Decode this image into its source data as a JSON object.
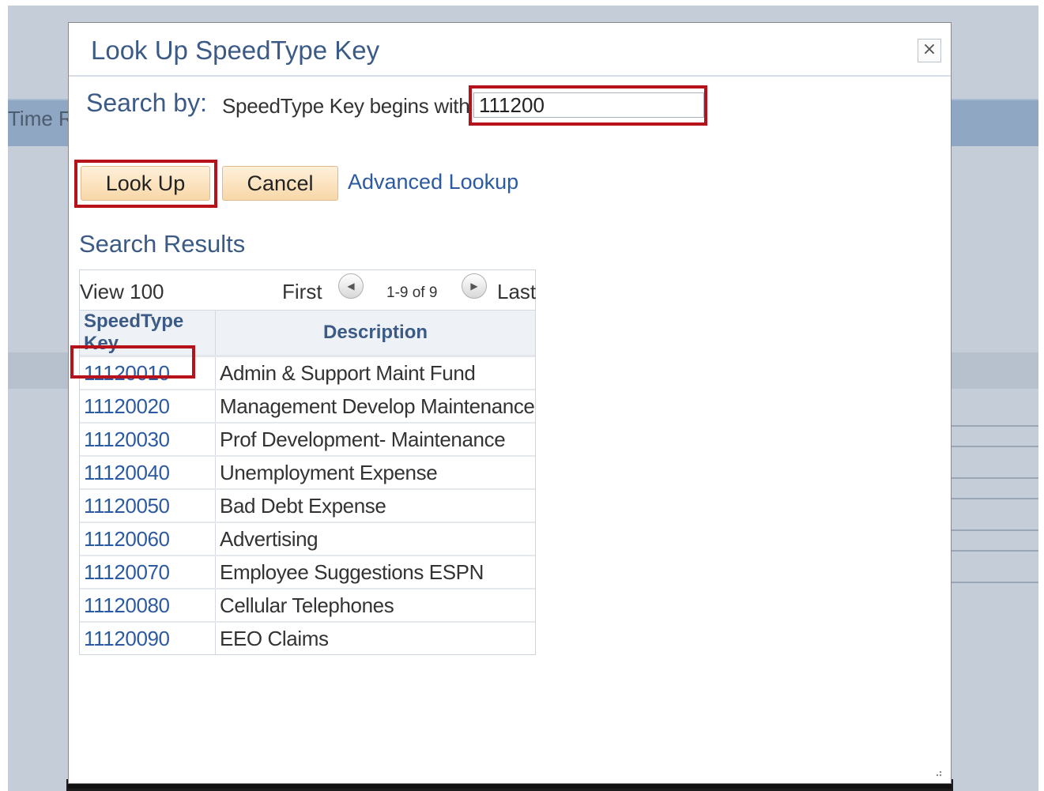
{
  "background": {
    "label_fragment": "Time R"
  },
  "dialog": {
    "title": "Look Up SpeedType Key",
    "close_glyph": "×",
    "search_by_label": "Search by:",
    "search_field_desc": "SpeedType Key begins with",
    "search_value": "111200",
    "lookup_button": "Look Up",
    "cancel_button": "Cancel",
    "advanced_link": "Advanced Lookup"
  },
  "results": {
    "heading": "Search Results",
    "nav": {
      "view": "View 100",
      "first": "First",
      "range": "1-9 of 9",
      "last": "Last"
    },
    "columns": [
      "SpeedType Key",
      "Description"
    ],
    "rows": [
      {
        "key": "11120010",
        "description": "Admin & Support Maint Fund"
      },
      {
        "key": "11120020",
        "description": "Management Develop Maintenance"
      },
      {
        "key": "11120030",
        "description": "Prof Development- Maintenance"
      },
      {
        "key": "11120040",
        "description": "Unemployment Expense"
      },
      {
        "key": "11120050",
        "description": "Bad Debt Expense"
      },
      {
        "key": "11120060",
        "description": "Advertising"
      },
      {
        "key": "11120070",
        "description": "Employee Suggestions ESPN"
      },
      {
        "key": "11120080",
        "description": "Cellular Telephones"
      },
      {
        "key": "11120090",
        "description": "EEO Claims"
      }
    ]
  },
  "colors": {
    "highlight": "#b5121b",
    "link": "#2c5aa0",
    "title": "#3b5a86",
    "button_fill": "#f8d7a8"
  }
}
